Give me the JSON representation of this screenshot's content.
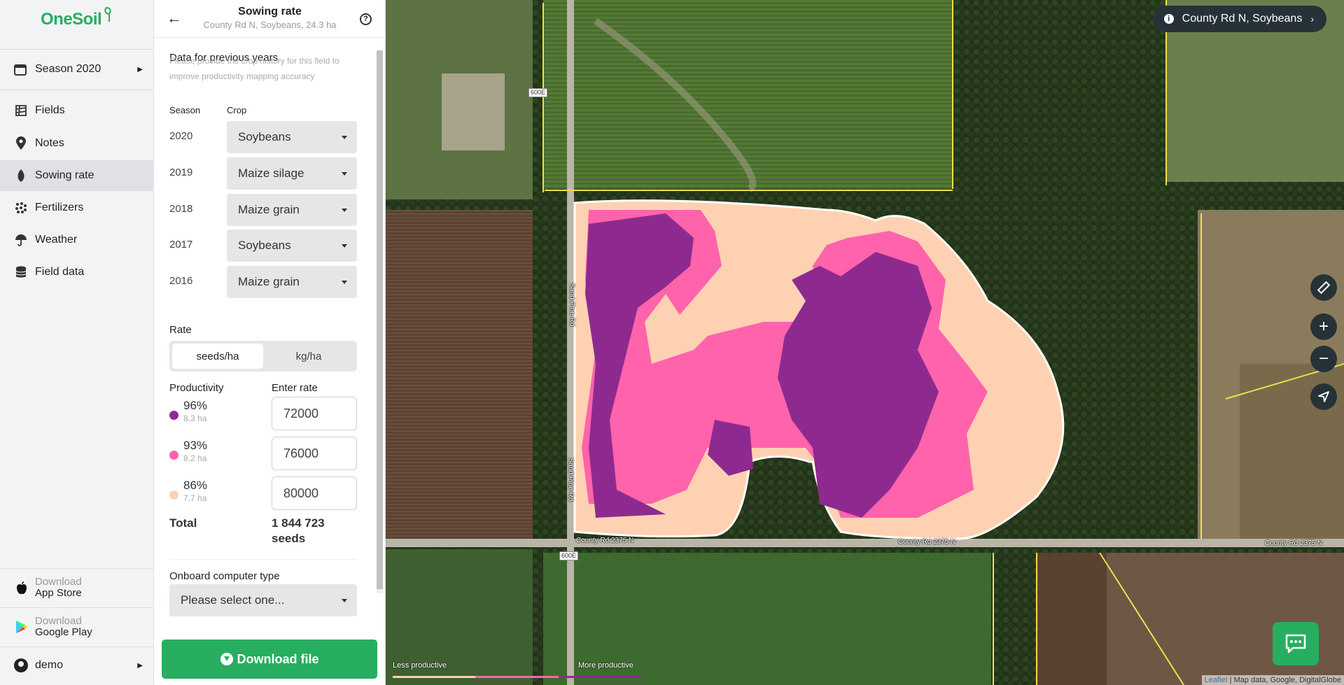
{
  "app": {
    "logo_text": "OneSoil",
    "brand_color": "#27ae60"
  },
  "nav": {
    "season_label": "Season 2020",
    "items": [
      {
        "label": "Fields",
        "icon": "fields-icon"
      },
      {
        "label": "Notes",
        "icon": "pin-icon"
      },
      {
        "label": "Sowing rate",
        "icon": "seed-icon",
        "active": true
      },
      {
        "label": "Fertilizers",
        "icon": "fertilizer-icon"
      },
      {
        "label": "Weather",
        "icon": "umbrella-icon"
      },
      {
        "label": "Field data",
        "icon": "database-icon"
      }
    ],
    "app_store": {
      "line1": "Download",
      "line2": "App Store"
    },
    "google_play": {
      "line1": "Download",
      "line2": "Google Play"
    },
    "user": "demo"
  },
  "panel": {
    "title": "Sowing rate",
    "subtitle": "County Rd N, Soybeans, 24.3 ha",
    "help": "?",
    "history_title": "Data for previous years",
    "history_hint": "Please provide the crop history for this field to improve productivity mapping accuracy",
    "col_season": "Season",
    "col_crop": "Crop",
    "history": [
      {
        "year": "2020",
        "crop": "Soybeans"
      },
      {
        "year": "2019",
        "crop": "Maize silage"
      },
      {
        "year": "2018",
        "crop": "Maize grain"
      },
      {
        "year": "2017",
        "crop": "Soybeans"
      },
      {
        "year": "2016",
        "crop": "Maize grain"
      }
    ],
    "rate_title": "Rate",
    "unit_seeds": "seeds/ha",
    "unit_kg": "kg/ha",
    "col_productivity": "Productivity",
    "col_enter_rate": "Enter rate",
    "zones": [
      {
        "pct": "96%",
        "area": "8.3 ha",
        "rate": "72000",
        "color": "#8e2a8f"
      },
      {
        "pct": "93%",
        "area": "8.2 ha",
        "rate": "76000",
        "color": "#ff63ab"
      },
      {
        "pct": "86%",
        "area": "7.7 ha",
        "rate": "80000",
        "color": "#ffd1b3"
      }
    ],
    "total_label": "Total",
    "total_value": "1 844 723",
    "total_unit": "seeds",
    "onboard_title": "Onboard computer type",
    "onboard_placeholder": "Please select one...",
    "download_label": "Download file"
  },
  "map": {
    "field_pill": "County Rd N, Soybeans",
    "road_labels": [
      "County Rd 2375 N",
      "County Rd 2375 N",
      "County Rd 2375 N",
      "Sand Pine Rd",
      "Sand Pine Rd"
    ],
    "shields": [
      "600E",
      "600E"
    ],
    "legend_less": "Less productive",
    "legend_more": "More productive",
    "attribution_leaflet": "Leaflet",
    "attribution_rest": "| Map data, Google, DigitalGlobe",
    "zoom_in": "+",
    "zoom_out": "−"
  }
}
